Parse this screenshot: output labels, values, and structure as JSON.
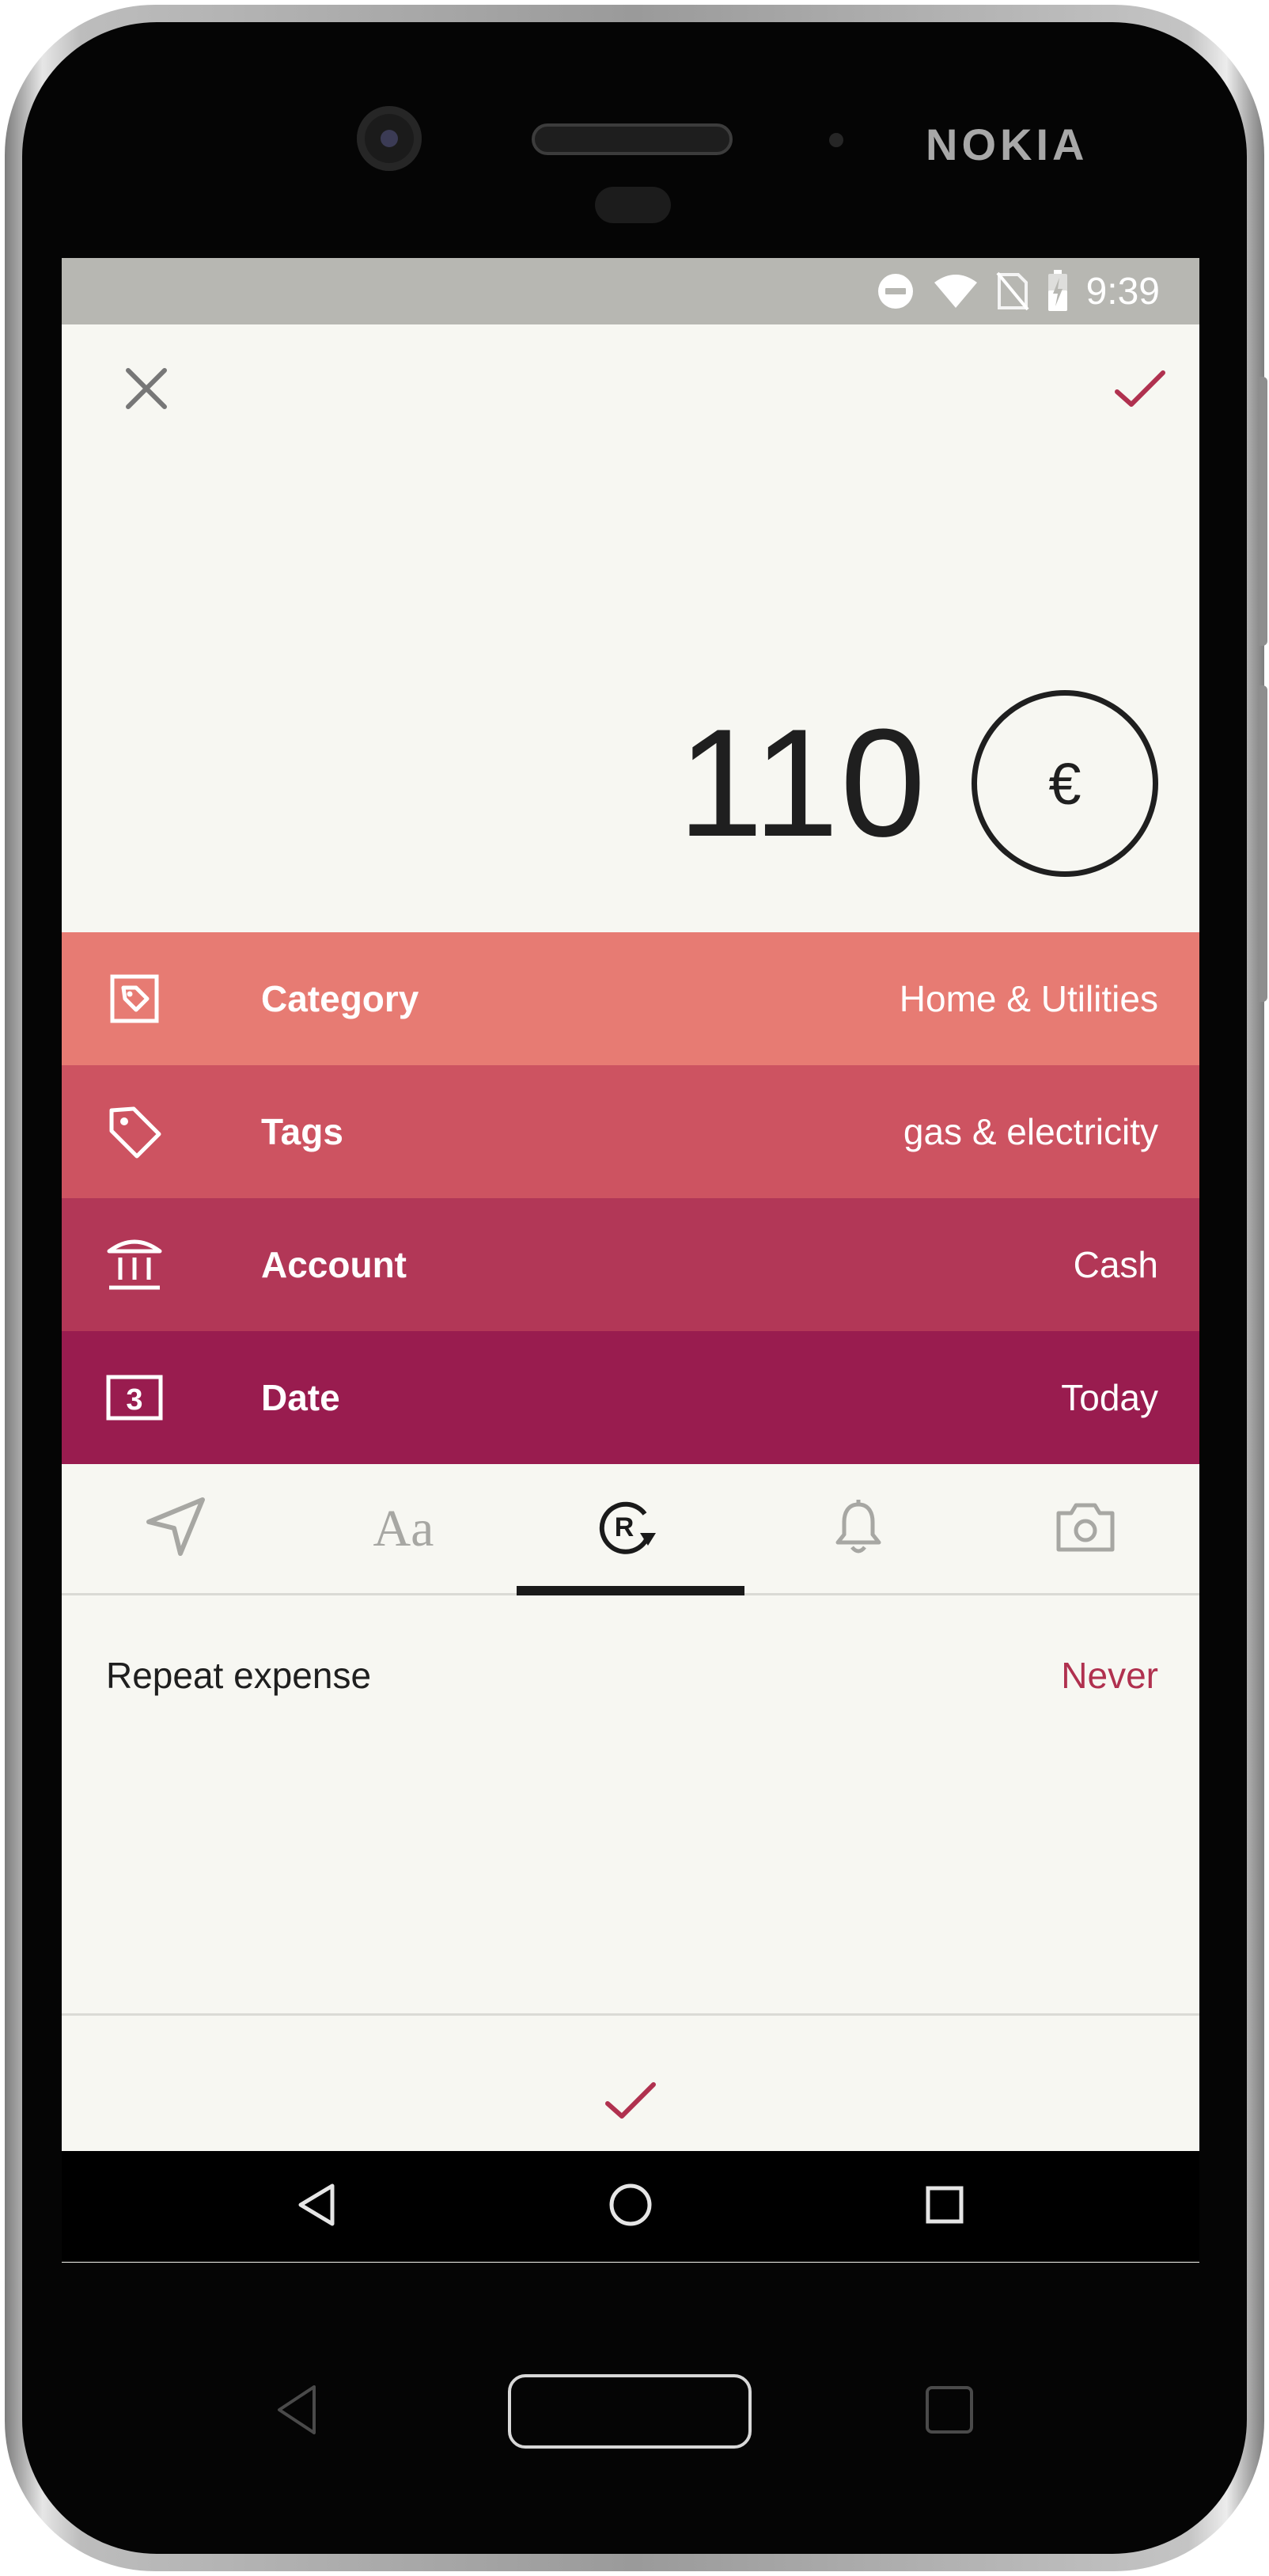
{
  "device": {
    "brand": "NOKIA"
  },
  "status_bar": {
    "time": "9:39",
    "icons": [
      "do-not-disturb-icon",
      "wifi-icon",
      "no-sim-icon",
      "battery-charging-icon"
    ]
  },
  "top_bar": {
    "close_icon": "close-icon",
    "confirm_icon": "check-icon"
  },
  "amount": {
    "value": "110",
    "currency_symbol": "€"
  },
  "fields": [
    {
      "label": "Category",
      "value": "Home & Utilities",
      "icon": "category-tag-icon",
      "color": "#e77b73"
    },
    {
      "label": "Tags",
      "value": "gas & electricity",
      "icon": "tag-icon",
      "color": "#cd5361"
    },
    {
      "label": "Account",
      "value": "Cash",
      "icon": "bank-icon",
      "color": "#b23757"
    },
    {
      "label": "Date",
      "value": "Today",
      "icon": "calendar-icon",
      "date_number": "3",
      "color": "#991c4f"
    }
  ],
  "tabs": [
    {
      "icon": "location-icon",
      "selected": false
    },
    {
      "icon": "text-note-icon",
      "text": "Aa",
      "selected": false
    },
    {
      "icon": "repeat-icon",
      "text": "R",
      "selected": true
    },
    {
      "icon": "reminder-bell-icon",
      "selected": false
    },
    {
      "icon": "camera-icon",
      "selected": false
    }
  ],
  "repeat": {
    "label": "Repeat expense",
    "value": "Never"
  },
  "bottom": {
    "confirm_icon": "check-icon"
  },
  "navbar": [
    "back-icon",
    "home-icon",
    "recents-icon"
  ],
  "colors": {
    "accent": "#b0314f",
    "background": "#f7f7f2",
    "status_bar": "#b7b7b2",
    "inactive_icon": "#a7a7a3"
  }
}
